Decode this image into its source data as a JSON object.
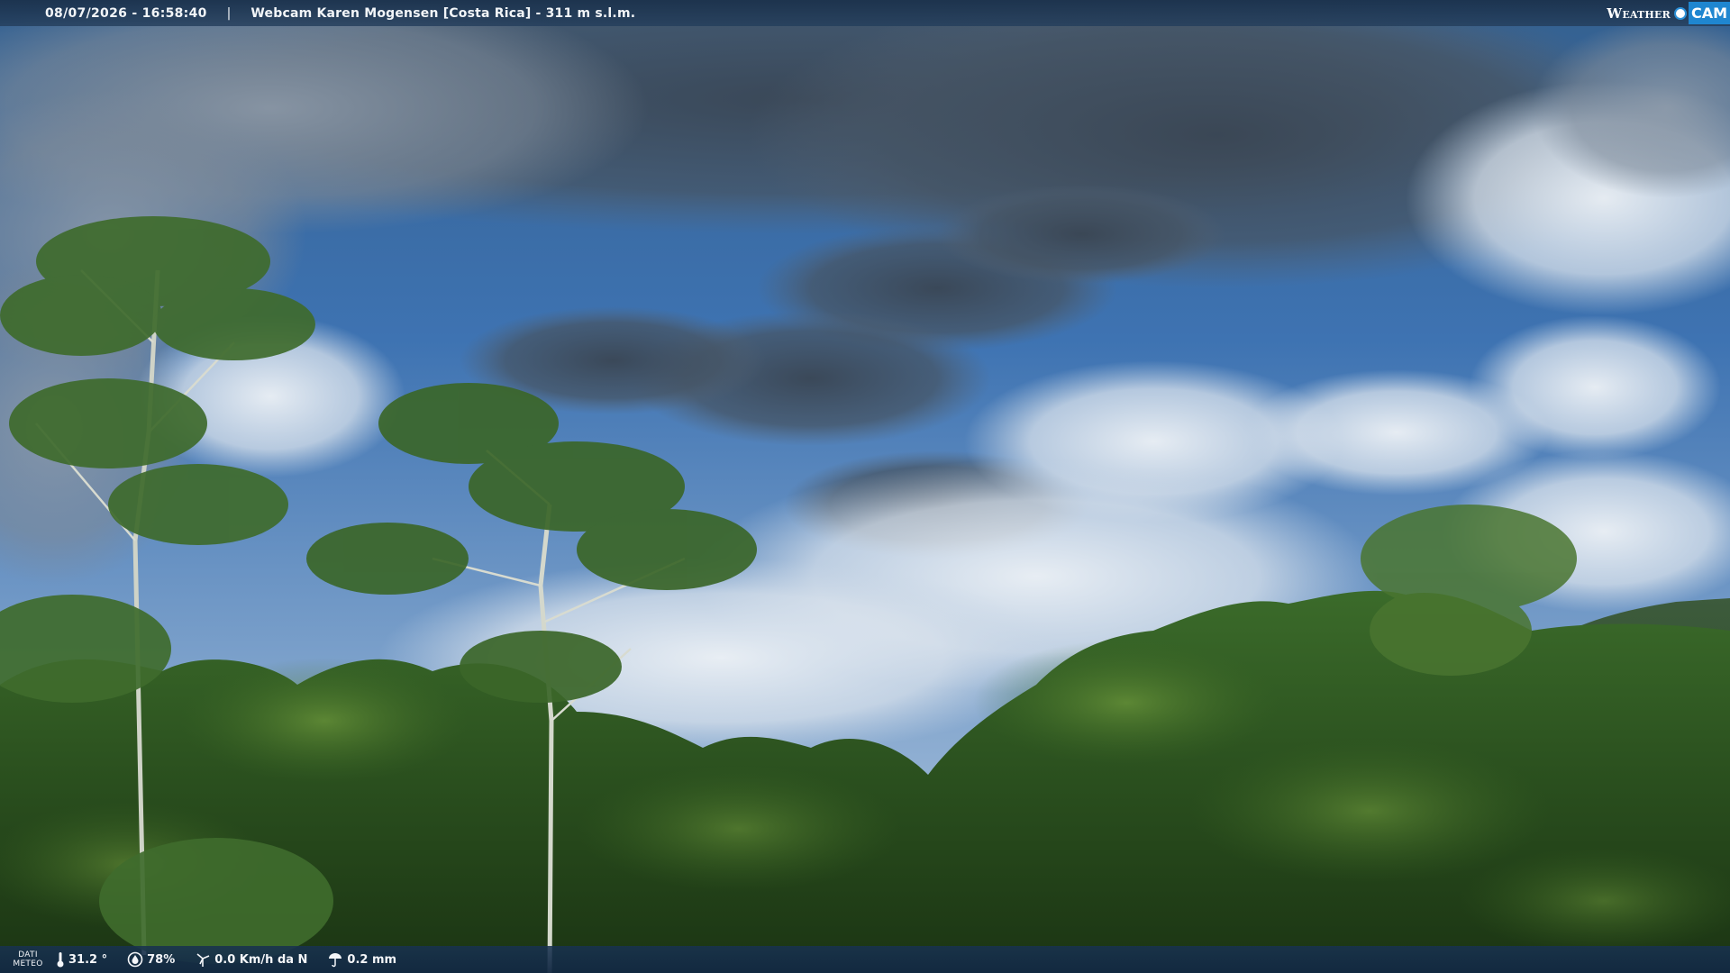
{
  "header": {
    "datetime": "08/07/2026 - 16:58:40",
    "separator": "|",
    "title": "Webcam Karen Mogensen [Costa Rica] - 311 m s.l.m."
  },
  "logo": {
    "text_weather": "Weather",
    "text_cam": "CAM"
  },
  "weather": {
    "label_line1": "DATI",
    "label_line2": "METEO",
    "temperature": "31.2 °",
    "humidity": "78%",
    "wind": "0.0 Km/h da N",
    "rain": "0.2 mm"
  },
  "colors": {
    "sky_top": "#3f6ea8",
    "sky_bottom": "#a9c3df",
    "cloud_dark": "#4a5868",
    "cloud_light": "#e8edf2",
    "foliage": "#2f5a22",
    "bar_bg": "#1a304a",
    "logo_blue": "#1f86d0"
  },
  "icons": [
    "thermometer-icon",
    "humidity-icon",
    "wind-icon",
    "rain-icon"
  ]
}
